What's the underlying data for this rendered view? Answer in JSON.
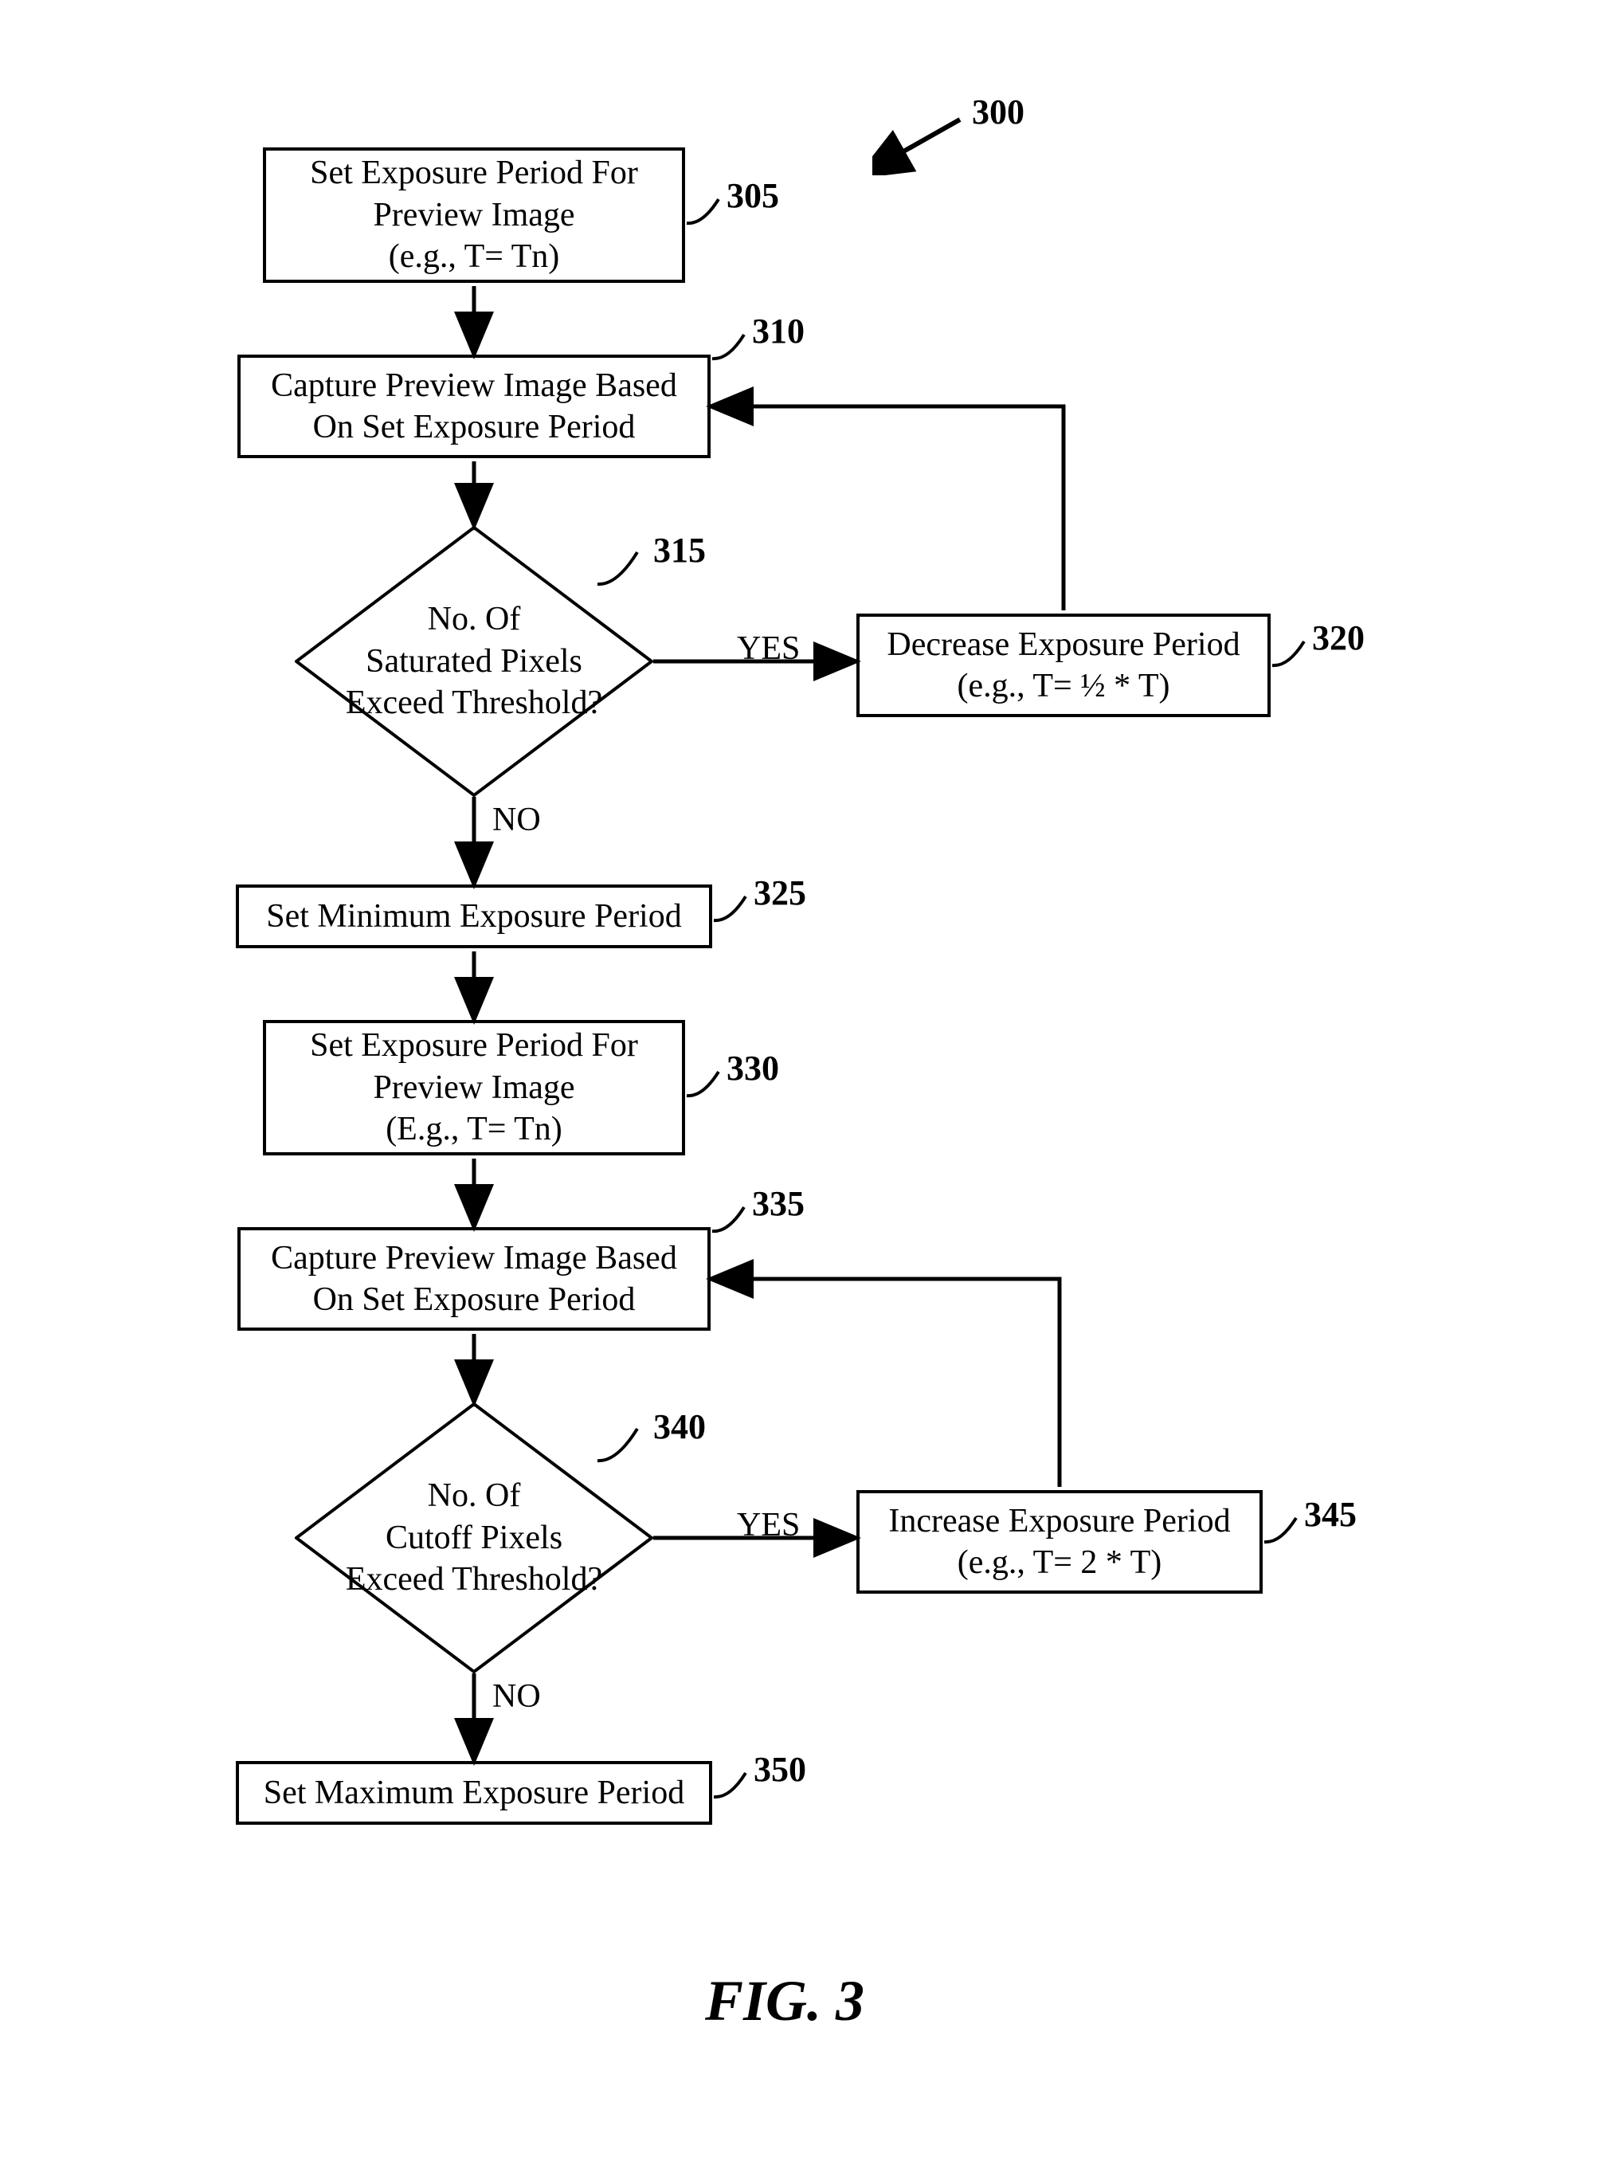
{
  "title_ref": "300",
  "figure_caption": "FIG. 3",
  "nodes": {
    "n305": {
      "ref": "305",
      "l1": "Set Exposure Period For",
      "l2": "Preview Image",
      "l3": "(e.g., T= Tn)"
    },
    "n310": {
      "ref": "310",
      "l1": "Capture Preview Image Based",
      "l2": "On Set Exposure Period"
    },
    "n315": {
      "ref": "315",
      "l1": "No. Of",
      "l2": "Saturated Pixels",
      "l3": "Exceed Threshold?"
    },
    "n320": {
      "ref": "320",
      "l1": "Decrease Exposure Period",
      "l2": "(e.g., T= ½ * T)"
    },
    "n325": {
      "ref": "325",
      "l1": "Set Minimum Exposure Period"
    },
    "n330": {
      "ref": "330",
      "l1": "Set Exposure Period For",
      "l2": "Preview Image",
      "l3": "(E.g., T= Tn)"
    },
    "n335": {
      "ref": "335",
      "l1": "Capture Preview Image Based",
      "l2": "On Set Exposure Period"
    },
    "n340": {
      "ref": "340",
      "l1": "No. Of",
      "l2": "Cutoff Pixels",
      "l3": "Exceed Threshold?"
    },
    "n345": {
      "ref": "345",
      "l1": "Increase Exposure Period",
      "l2": "(e.g., T= 2 * T)"
    },
    "n350": {
      "ref": "350",
      "l1": "Set Maximum Exposure Period"
    }
  },
  "labels": {
    "yes": "YES",
    "no": "NO"
  }
}
